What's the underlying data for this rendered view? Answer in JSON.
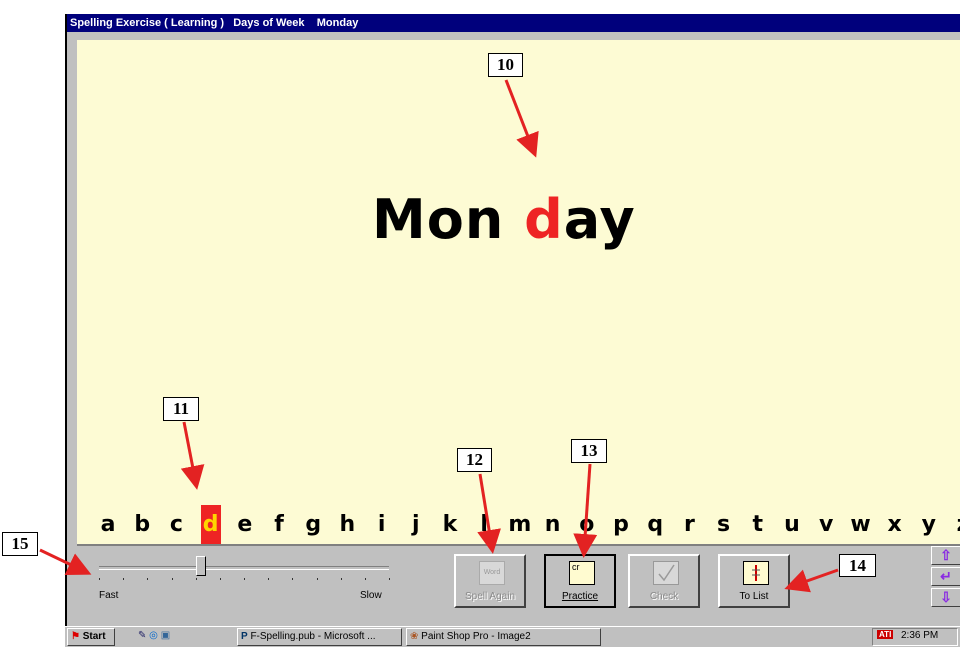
{
  "window": {
    "title": "Spelling Exercise ( Learning )   Days of Week    Monday"
  },
  "exercise": {
    "word_part1": "Mon",
    "word_space": " ",
    "word_highlight": "d",
    "word_part2": "ay",
    "highlight_color": "#ee2424"
  },
  "alphabet": {
    "letters": [
      "a",
      "b",
      "c",
      "d",
      "e",
      "f",
      "g",
      "h",
      "i",
      "j",
      "k",
      "l",
      "m",
      "n",
      "o",
      "p",
      "q",
      "r",
      "s",
      "t",
      "u",
      "v",
      "w",
      "x",
      "y",
      "z"
    ],
    "selected": "d"
  },
  "speed_slider": {
    "min_label": "Fast",
    "max_label": "Slow",
    "level_fraction": 0.35
  },
  "buttons": {
    "spell_again": {
      "label": "Spell Again",
      "icon_text": "Word",
      "enabled": false
    },
    "practice": {
      "label": "Practice",
      "icon_text": "cr",
      "enabled": true
    },
    "check": {
      "label": "Check",
      "enabled": false
    },
    "to_list": {
      "label": "To List",
      "enabled": true
    }
  },
  "nav": {
    "up_icon": "arrow-up-icon",
    "return_icon": "return-icon",
    "down_icon": "arrow-down-icon"
  },
  "taskbar": {
    "start_label": "Start",
    "tasks": [
      "F-Spelling.pub - Microsoft ...",
      "Paint Shop Pro - Image2"
    ],
    "clock": "2:36 PM"
  },
  "callouts": {
    "c10": "10",
    "c11": "11",
    "c12": "12",
    "c13": "13",
    "c14": "14",
    "c15": "15"
  },
  "colors": {
    "arrow": "#e32222",
    "title_bar": "#00007c",
    "canvas": "#fdfbd4"
  }
}
